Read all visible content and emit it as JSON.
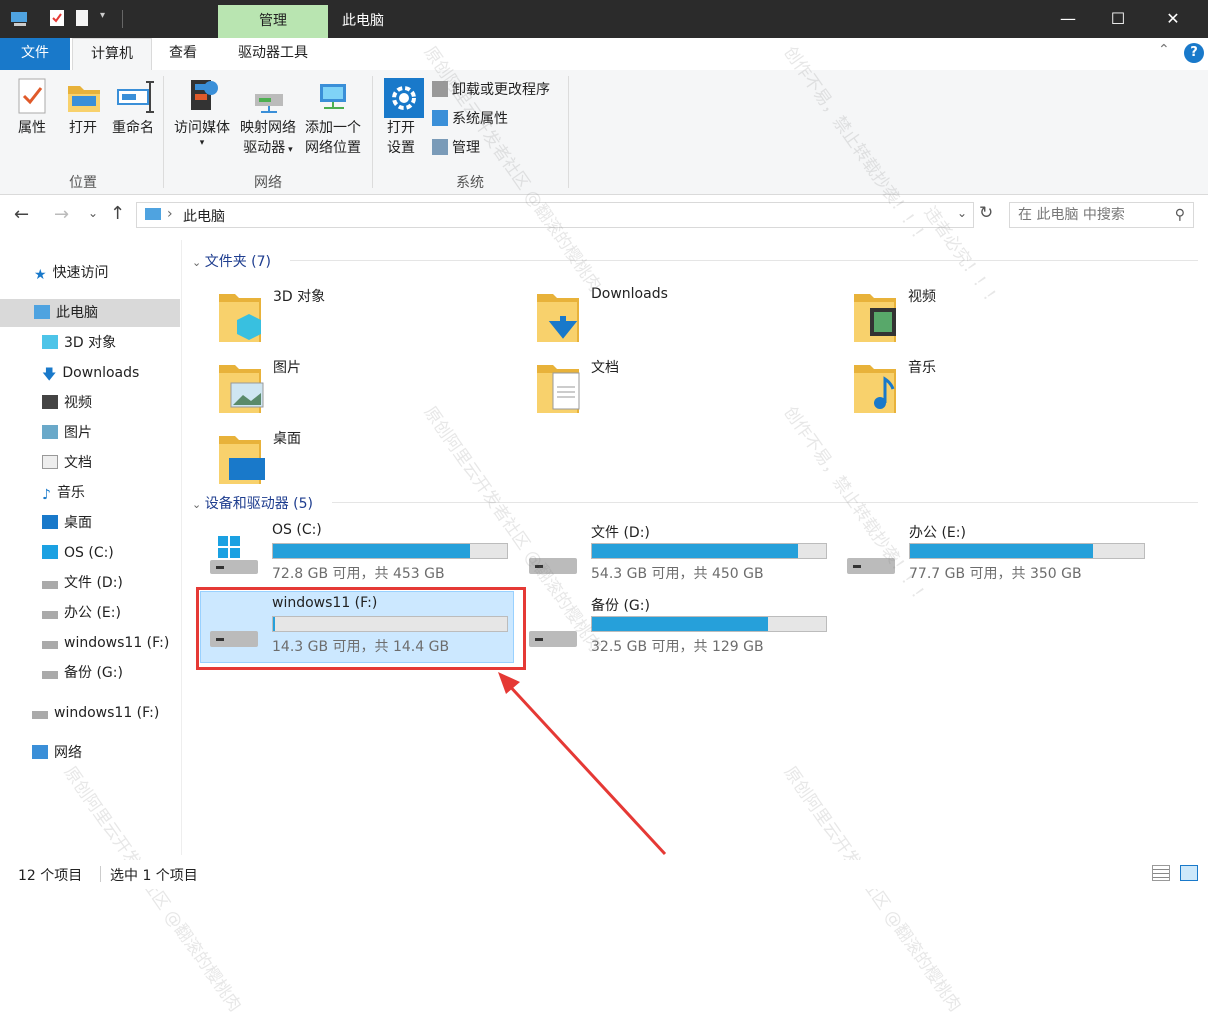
{
  "titlebar": {
    "manage_tab": "管理",
    "title": "此电脑",
    "minimize": "—",
    "maximize": "☐",
    "close": "✕"
  },
  "tabs": {
    "file": "文件",
    "computer": "计算机",
    "view": "查看",
    "drive_tools": "驱动器工具"
  },
  "ribbon": {
    "properties": "属性",
    "open": "打开",
    "rename": "重命名",
    "group_location": "位置",
    "access_media": "访问媒体",
    "map_drive_1": "映射网络",
    "map_drive_2": "驱动器",
    "add_location_1": "添加一个",
    "add_location_2": "网络位置",
    "group_network": "网络",
    "open_settings_1": "打开",
    "open_settings_2": "设置",
    "uninstall": "卸载或更改程序",
    "system_props": "系统属性",
    "manage": "管理",
    "group_system": "系统"
  },
  "nav": {
    "path": "此电脑",
    "search_placeholder": "在 此电脑 中搜索"
  },
  "sidebar": {
    "quick_access": "快速访问",
    "this_pc": "此电脑",
    "items": [
      "3D 对象",
      "Downloads",
      "视频",
      "图片",
      "文档",
      "音乐",
      "桌面",
      "OS (C:)",
      "文件 (D:)",
      "办公 (E:)",
      "windows11 (F:)",
      "备份 (G:)"
    ],
    "usb": "windows11 (F:)",
    "network": "网络"
  },
  "content": {
    "folders_header": "文件夹 (7)",
    "folders": [
      "3D 对象",
      "Downloads",
      "视频",
      "图片",
      "文档",
      "音乐",
      "桌面"
    ],
    "drives_header": "设备和驱动器 (5)",
    "drives": [
      {
        "name": "OS (C:)",
        "size": "72.8 GB 可用，共 453 GB",
        "used_fraction": 0.84
      },
      {
        "name": "文件 (D:)",
        "size": "54.3 GB 可用，共 450 GB",
        "used_fraction": 0.88
      },
      {
        "name": "办公 (E:)",
        "size": "77.7 GB 可用，共 350 GB",
        "used_fraction": 0.78
      },
      {
        "name": "windows11 (F:)",
        "size": "14.3 GB 可用，共 14.4 GB",
        "used_fraction": 0.01
      },
      {
        "name": "备份 (G:)",
        "size": "32.5 GB 可用，共 129 GB",
        "used_fraction": 0.75
      }
    ]
  },
  "status": {
    "count": "12 个项目",
    "selected": "选中 1 个项目"
  },
  "watermark": {
    "line1": "创作不易，禁止转载抄袭！！！",
    "line2": "原创阿里云开发者社区 @翻滚的樱桃肉",
    "line3": "违者必究！！！"
  },
  "colors": {
    "accent": "#1979ca",
    "bar_fill": "#26a0da",
    "selection": "#cce8ff",
    "highlight": "#e53935",
    "manage_tab": "#b9e5b1"
  }
}
